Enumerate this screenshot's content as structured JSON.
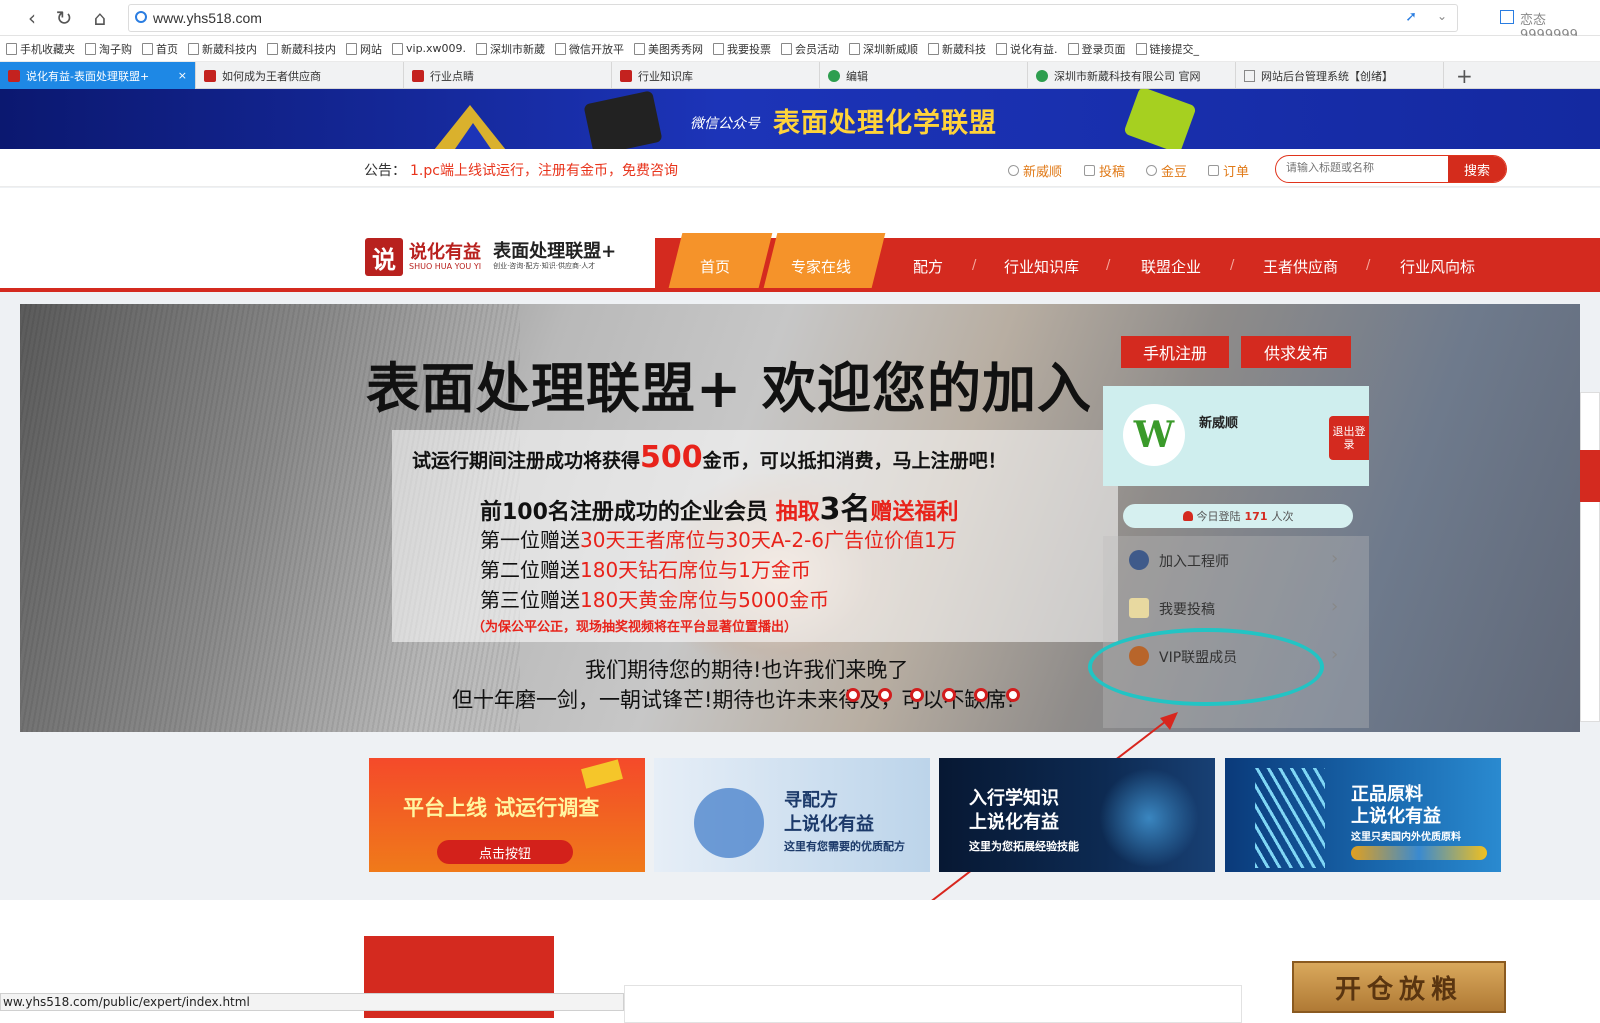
{
  "browser": {
    "url": "www.yhs518.com",
    "profile": "恋态9999999",
    "bookmarks": [
      "手机收藏夹",
      "淘子购",
      "首页",
      "新葳科技内",
      "新葳科技内",
      "网站",
      "vip.xw009.",
      "深圳市新葳",
      "微信开放平",
      "美图秀秀网",
      "我要投票",
      "会员活动",
      "深圳新威顺",
      "新葳科技",
      "说化有益.",
      "登录页面",
      "链接提交_"
    ],
    "tabs": [
      "说化有益-表面处理联盟+",
      "如何成为王者供应商",
      "行业点睛",
      "行业知识库",
      "编辑",
      "深圳市新葳科技有限公司 官网",
      "网站后台管理系统【创绪】"
    ]
  },
  "banner": {
    "sub": "微信公众号",
    "title": "表面处理化学联盟"
  },
  "notice": {
    "label": "公告：",
    "text": "1.pc端上线试运行，注册有金币，免费咨询"
  },
  "toplinks": [
    "新威顺",
    "投稿",
    "金豆",
    "订单"
  ],
  "search": {
    "placeholder": "请输入标题或名称",
    "button": "搜索"
  },
  "logo": {
    "mark": "说",
    "name": "说化有益",
    "en": "SHUO HUA YOU YI",
    "sub": "表面处理联盟+",
    "tag": "创业·咨询·配方·知识·供应商·人才"
  },
  "nav": [
    "首页",
    "专家在线",
    "配方",
    "行业知识库",
    "联盟企业",
    "王者供应商",
    "行业风向标"
  ],
  "hero": {
    "title": "表面处理联盟+ 欢迎您的加入",
    "l1a": "试运行期间注册成功将获得",
    "l1b": "500",
    "l1c": "金币，可以抵扣消费，马上注册吧！",
    "l2a": "前100名注册成功的企业会员 ",
    "l2b": "抽取",
    "l2c": "3名",
    "l2d": "赠送福利",
    "l3a": "第一位赠送",
    "l3b": "30天王者席位与30天A-2-6广告位价值1万",
    "l4a": "第二位赠送",
    "l4b": "180天钻石席位与1万金币",
    "l5a": "第三位赠送",
    "l5b": "180天黄金席位与5000金币",
    "l6": "（为保公平公正，现场抽奖视频将在平台显著位置播出）",
    "tag1": "我们期待您的期待!也许我们来晚了",
    "tag2": "但十年磨一剑，一朝试锋芒!期待也许未来得及，可以不缺席!"
  },
  "panel": {
    "register": "手机注册",
    "publish": "供求发布",
    "avatar": "W",
    "username": "新威顺",
    "logout": "退出登录",
    "logins_pre": "今日登陆",
    "logins_count": "171",
    "logins_post": "人次",
    "menu": [
      "加入工程师",
      "我要投稿",
      "VIP联盟成员"
    ]
  },
  "ads": {
    "a1": {
      "title": "平台上线 试运行调查",
      "btn": "点击按钮"
    },
    "a2": {
      "l1": "寻配方",
      "l2": "上说化有益",
      "l3": "这里有您需要的优质配方"
    },
    "a3": {
      "l1": "入行学知识",
      "l2": "上说化有益",
      "l3": "这里为您拓展经验技能"
    },
    "a4": {
      "l1": "正品原料",
      "l2": "上说化有益",
      "l3": "这里只卖国内外优质原料"
    }
  },
  "bottom": {
    "kaicang": "开仓放粮",
    "status": "ww.yhs518.com/public/expert/index.html"
  }
}
